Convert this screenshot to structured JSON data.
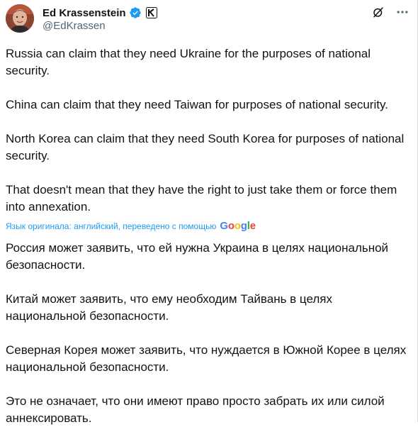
{
  "author": {
    "display_name": "Ed Krassenstein",
    "handle": "@EdKrassen",
    "verified": true
  },
  "icons": {
    "verified": "verified-badge-icon",
    "affiliate": "affiliate-badge-icon",
    "grok": "grok-icon",
    "more": "more-options-icon"
  },
  "tweet": {
    "paragraphs": [
      "Russia can claim that they need Ukraine for the purposes of national security.",
      "China can claim that they need Taiwan for purposes of national security.",
      "North Korea can claim that they need South Korea for purposes of national security.",
      "That doesn't mean that they have the right to just take them or force them into annexation."
    ]
  },
  "translation": {
    "note": "Язык оригинала: английский, переведено с помощью",
    "provider": "Google",
    "paragraphs": [
      "Россия может заявить, что ей нужна Украина в целях национальной безопасности.",
      "Китай может заявить, что ему необходим Тайвань в целях национальной безопасности.",
      "Северная Корея может заявить, что нуждается в Южной Корее в целях национальной безопасности.",
      "Это не означает, что они имеют право просто забрать их или силой аннексировать."
    ]
  },
  "colors": {
    "text": "#0f1419",
    "secondary": "#536471",
    "link": "#1d9bf0",
    "verified": "#1d9bf0"
  }
}
